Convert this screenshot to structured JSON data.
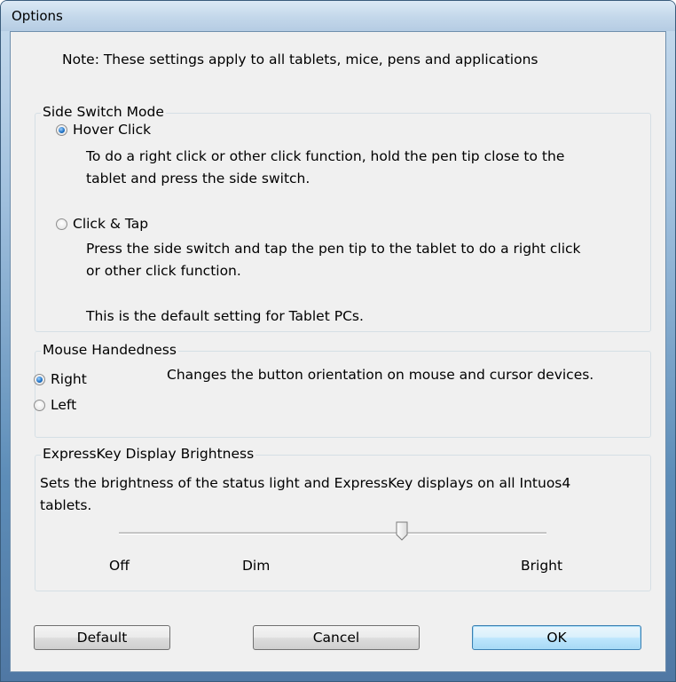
{
  "window": {
    "title": "Options"
  },
  "note": "Note: These settings apply to all tablets, mice, pens and applications",
  "side_switch": {
    "label": "Side Switch Mode",
    "options": [
      {
        "label": "Hover Click",
        "selected": true,
        "description_lines": [
          "To do a right click or other click function, hold the pen tip close to the",
          "tablet and press the side switch."
        ]
      },
      {
        "label": "Click & Tap",
        "selected": false,
        "description_lines": [
          "Press the side switch and tap the pen tip to the tablet to do a right click",
          "or other click function."
        ],
        "default_note": "This is the default setting for Tablet PCs."
      }
    ]
  },
  "handedness": {
    "label": "Mouse Handedness",
    "options": [
      {
        "label": "Right",
        "selected": true
      },
      {
        "label": "Left",
        "selected": false
      }
    ],
    "description": "Changes the button orientation on mouse and cursor devices."
  },
  "brightness": {
    "label": "ExpressKey Display Brightness",
    "description_lines": [
      "Sets the brightness of the status light and ExpressKey displays on all Intuos4",
      "tablets."
    ],
    "slider_value_fraction": 0.67,
    "ticks": {
      "off": "Off",
      "dim": "Dim",
      "bright": "Bright"
    }
  },
  "buttons": {
    "default": "Default",
    "cancel": "Cancel",
    "ok": "OK"
  },
  "colors": {
    "title_bar": "#c3d7ea",
    "dialog_bg": "#f0f0f0",
    "focus_button": "#bee6fd",
    "radio_selected": "#1b6fc4"
  }
}
